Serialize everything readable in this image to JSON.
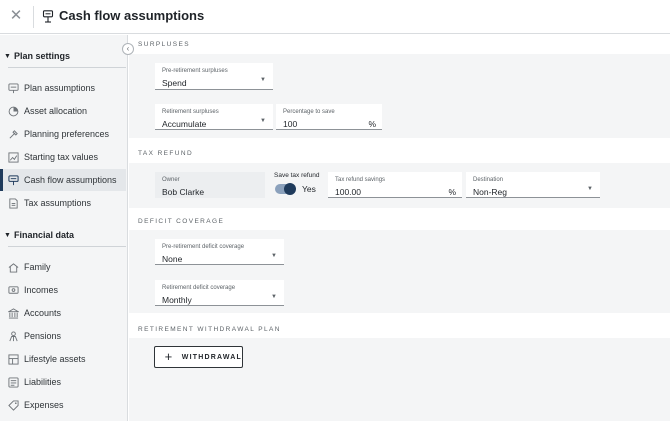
{
  "header": {
    "title": "Cash flow assumptions",
    "close_glyph": "✕",
    "icon": "cash-flow-icon"
  },
  "sidebar": {
    "collapse_glyph": "‹",
    "sections": [
      {
        "title": "Plan settings",
        "items": [
          {
            "label": "Plan assumptions",
            "icon": "plan-assumptions-icon"
          },
          {
            "label": "Asset allocation",
            "icon": "asset-allocation-icon"
          },
          {
            "label": "Planning preferences",
            "icon": "planning-preferences-icon"
          },
          {
            "label": "Starting tax values",
            "icon": "starting-tax-values-icon"
          },
          {
            "label": "Cash flow assumptions",
            "icon": "cash-flow-icon",
            "active": true
          },
          {
            "label": "Tax assumptions",
            "icon": "tax-assumptions-icon"
          }
        ]
      },
      {
        "title": "Financial data",
        "items": [
          {
            "label": "Family",
            "icon": "family-icon"
          },
          {
            "label": "Incomes",
            "icon": "incomes-icon"
          },
          {
            "label": "Accounts",
            "icon": "accounts-icon"
          },
          {
            "label": "Pensions",
            "icon": "pensions-icon"
          },
          {
            "label": "Lifestyle assets",
            "icon": "lifestyle-assets-icon"
          },
          {
            "label": "Liabilities",
            "icon": "liabilities-icon"
          },
          {
            "label": "Expenses",
            "icon": "expenses-icon"
          }
        ]
      }
    ]
  },
  "main": {
    "surpluses": {
      "title": "SURPLUSES",
      "pre_retirement": {
        "label": "Pre-retirement surpluses",
        "value": "Spend"
      },
      "retirement": {
        "label": "Retirement surpluses",
        "value": "Accumulate"
      },
      "percentage": {
        "label": "Percentage to save",
        "value": "100",
        "suffix": "%"
      }
    },
    "tax_refund": {
      "title": "TAX REFUND",
      "owner": {
        "label": "Owner",
        "value": "Bob Clarke"
      },
      "save_toggle": {
        "label": "Save tax refund",
        "state_text": "Yes",
        "on": true
      },
      "savings": {
        "label": "Tax refund savings",
        "value": "100.00",
        "suffix": "%"
      },
      "destination": {
        "label": "Destination",
        "value": "Non-Reg"
      }
    },
    "deficit": {
      "title": "DEFICIT COVERAGE",
      "pre_retirement": {
        "label": "Pre-retirement deficit coverage",
        "value": "None"
      },
      "retirement": {
        "label": "Retirement deficit coverage",
        "value": "Monthly"
      }
    },
    "withdrawal_plan": {
      "title": "RETIREMENT WITHDRAWAL PLAN",
      "button_label": "WITHDRAWAL",
      "button_glyph": "+"
    }
  },
  "colors": {
    "accent": "#1f3b5c",
    "sidebar_bg": "#f4f5f6",
    "band_bg": "#f4f5f6"
  }
}
